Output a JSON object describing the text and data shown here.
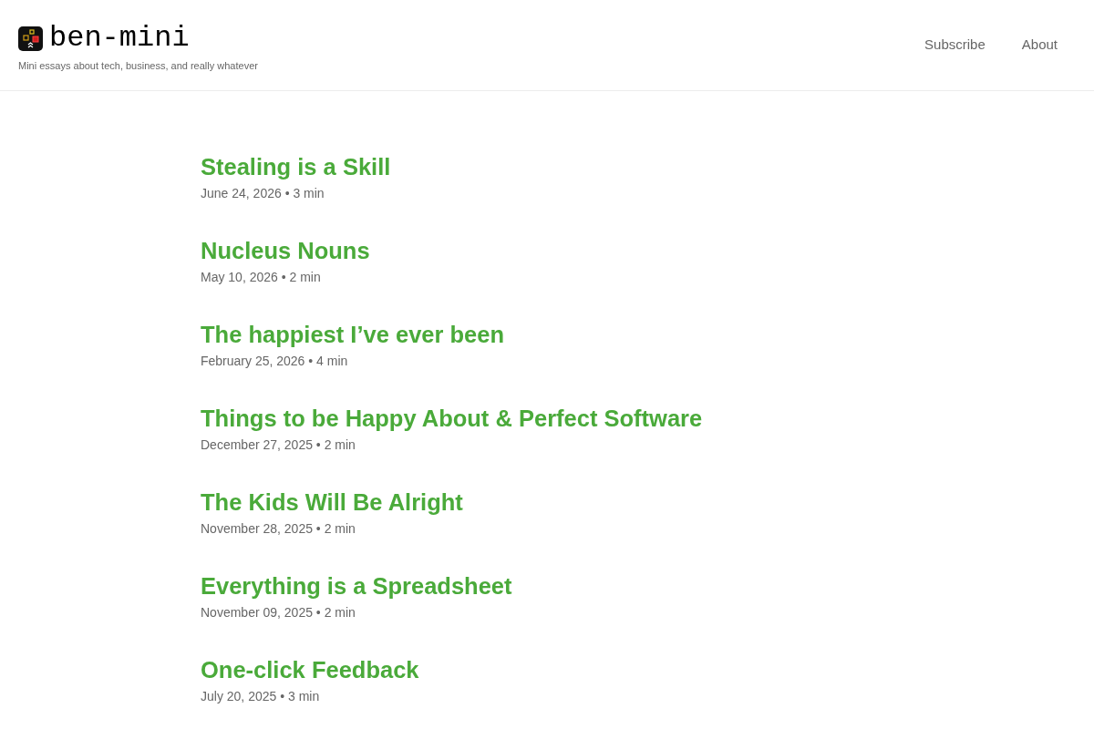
{
  "site": {
    "title": "ben-mini",
    "tagline": "Mini essays about tech, business, and really whatever"
  },
  "nav": [
    {
      "label": "Subscribe"
    },
    {
      "label": "About"
    }
  ],
  "posts": [
    {
      "title": "Stealing is a Skill",
      "meta": "June 24, 2026 • 3 min"
    },
    {
      "title": "Nucleus Nouns",
      "meta": "May 10, 2026 • 2 min"
    },
    {
      "title": "The happiest I’ve ever been",
      "meta": "February 25, 2026 • 4 min"
    },
    {
      "title": "Things to be Happy About & Perfect Software",
      "meta": "December 27, 2025 • 2 min"
    },
    {
      "title": "The Kids Will Be Alright",
      "meta": "November 28, 2025 • 2 min"
    },
    {
      "title": "Everything is a Spreadsheet",
      "meta": "November 09, 2025 • 2 min"
    },
    {
      "title": "One-click Feedback",
      "meta": "July 20, 2025 • 3 min"
    }
  ]
}
